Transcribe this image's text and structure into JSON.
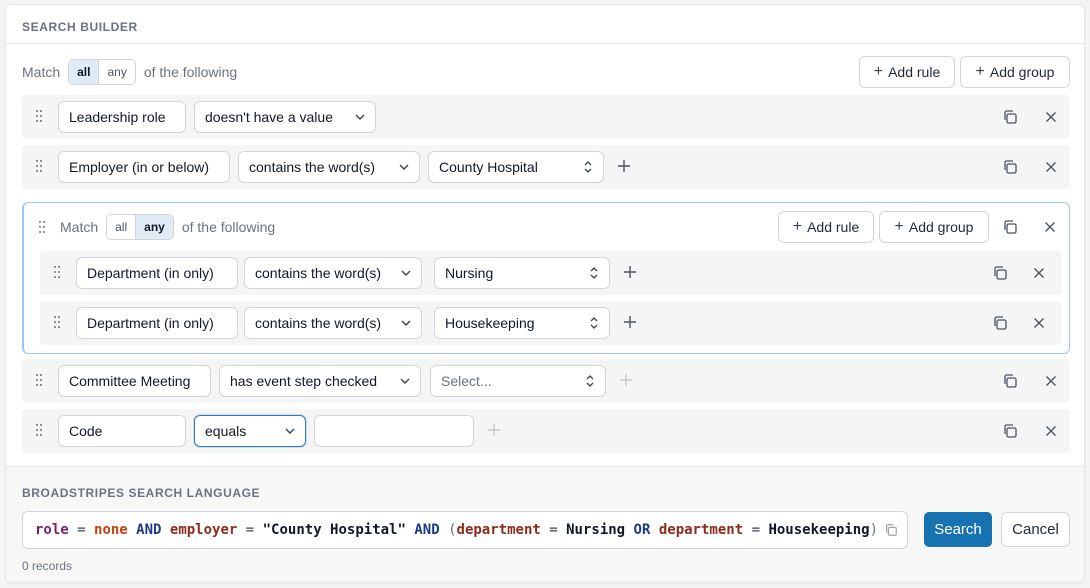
{
  "builder": {
    "title": "SEARCH BUILDER",
    "match_label": "Match",
    "match_options": [
      "all",
      "any"
    ],
    "match_selected": "all",
    "match_suffix": "of the following",
    "add_rule": "Add rule",
    "add_group": "Add group"
  },
  "rules": [
    {
      "field": "Leadership role",
      "operator": "doesn't have a value"
    },
    {
      "field": "Employer (in or below)",
      "operator": "contains the word(s)",
      "value": "County Hospital"
    }
  ],
  "group": {
    "match_label": "Match",
    "match_options": [
      "all",
      "any"
    ],
    "match_selected": "any",
    "match_suffix": "of the following",
    "add_rule": "Add rule",
    "add_group": "Add group",
    "rules": [
      {
        "field": "Department (in only)",
        "operator": "contains the word(s)",
        "value": "Nursing"
      },
      {
        "field": "Department (in only)",
        "operator": "contains the word(s)",
        "value": "Housekeeping"
      }
    ]
  },
  "rules_after": [
    {
      "field": "Committee Meeting",
      "operator": "has event step checked",
      "value_placeholder": "Select..."
    },
    {
      "field": "Code",
      "operator": "equals",
      "value": ""
    }
  ],
  "language": {
    "title": "BROADSTRIPES SEARCH LANGUAGE",
    "tokens": [
      {
        "t": "role",
        "c": "kw-field"
      },
      {
        "t": " = ",
        "c": "kw-eq"
      },
      {
        "t": "none",
        "c": "kw-val"
      },
      {
        "t": " AND ",
        "c": "kw-op"
      },
      {
        "t": "employer",
        "c": "kw-field b"
      },
      {
        "t": " = ",
        "c": "kw-eq"
      },
      {
        "t": "\"County Hospital\"",
        "c": "kw-str"
      },
      {
        "t": " AND ",
        "c": "kw-op"
      },
      {
        "t": "(",
        "c": "kw-paren"
      },
      {
        "t": "department",
        "c": "kw-field b"
      },
      {
        "t": " = ",
        "c": "kw-eq"
      },
      {
        "t": "Nursing",
        "c": "kw-str"
      },
      {
        "t": " OR ",
        "c": "kw-op"
      },
      {
        "t": "department",
        "c": "kw-field b"
      },
      {
        "t": " = ",
        "c": "kw-eq"
      },
      {
        "t": "Housekeeping",
        "c": "kw-str"
      },
      {
        "t": ")",
        "c": "kw-paren"
      }
    ],
    "search_label": "Search",
    "cancel_label": "Cancel",
    "records": "0 records"
  },
  "colors": {
    "accent": "#1672b0",
    "group_border": "#9fc7e3",
    "selected_seg": "#e0ecf5"
  },
  "icons": {
    "drag": "drag-handle-icon",
    "copy": "copy-icon",
    "close": "close-icon",
    "add": "plus-icon",
    "chevron": "chevron-down-icon",
    "updown": "chevron-up-down-icon"
  }
}
